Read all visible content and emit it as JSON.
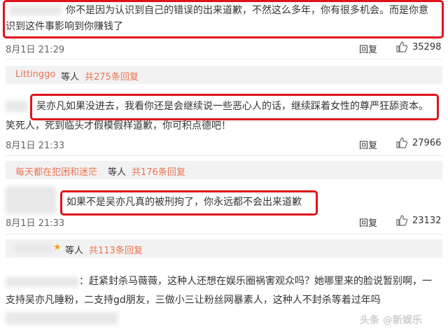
{
  "comments": [
    {
      "text_line1": "你不是因为认识到自己的错误的出来道歉，不然这么多年，你有很多机会。而是你意",
      "text_line2": "识到这件事影响到你赚钱了",
      "time": "8月1日 21:29",
      "reply_label": "回复",
      "likes": "35298"
    },
    {
      "replier": "Littinggo",
      "others_label": "等人",
      "total_replies": "共275条回复",
      "boxed_text": "吴亦凡如果没进去，我看你还是会继续说一些恶心人的话，继续踩着女性的尊严狂舔资本。",
      "text": "笑死人，死到临头才假模假样道歉，你可积点德吧！",
      "time": "8月1日 21:33",
      "reply_label": "回复",
      "likes": "27966"
    },
    {
      "replier": "每天都在犯困和迷茫",
      "others_label": "等人",
      "total_replies": "共176条回复",
      "boxed_text": "如果不是吴亦凡真的被刑拘了，你永远都不会出来道歉",
      "time": "8月1日 21:33",
      "reply_label": "回复",
      "likes": "23132"
    },
    {
      "others_label": "等人",
      "total_replies": "共113条回复",
      "text_line1": "：赶紧封杀马薇薇，这种人还想在娱乐圈祸害观众吗？她哪里来的脸说暂别啊，一",
      "text_line2": "支持吴亦凡睡粉，二支持gd朋友，三做小三让粉丝网暴素人，这种人不封杀等着过年吗"
    }
  ],
  "watermark": "头条 @新娱乐"
}
